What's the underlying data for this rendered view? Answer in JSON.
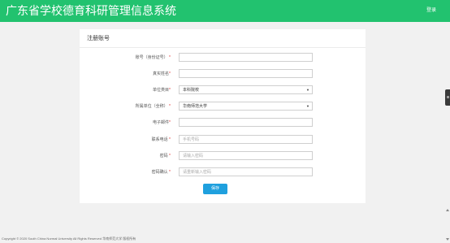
{
  "header": {
    "title": "广东省学校德育科研管理信息系统",
    "login_label": "登录"
  },
  "card": {
    "heading": "注册账号"
  },
  "form": {
    "fields": [
      {
        "label": "账号（身份证号）",
        "required": "*",
        "type": "text",
        "value": "",
        "placeholder": ""
      },
      {
        "label": "真实姓名",
        "required": "*",
        "type": "text",
        "value": "",
        "placeholder": ""
      },
      {
        "label": "单位类目",
        "required": "*",
        "type": "select",
        "value": "本科院校",
        "placeholder": ""
      },
      {
        "label": "所属单位（全称）",
        "required": "*",
        "type": "select",
        "value": "华南师范大学",
        "placeholder": ""
      },
      {
        "label": "电子邮件",
        "required": "*",
        "type": "text",
        "value": "",
        "placeholder": ""
      },
      {
        "label": "联系电话",
        "required": "*",
        "type": "text",
        "value": "",
        "placeholder": "手机号码"
      },
      {
        "label": "密码",
        "required": "*",
        "type": "password",
        "value": "",
        "placeholder": "请输入密码"
      },
      {
        "label": "密码确认",
        "required": "*",
        "type": "password",
        "value": "",
        "placeholder": "请重新输入密码"
      }
    ],
    "save_label": "保存"
  },
  "footer": {
    "copyright": "Copyright © 2020 South China Normal University All Rights Reserved 华南师范大学 版权所有"
  },
  "colors": {
    "header_bg": "#22c26f",
    "button_bg": "#1fa0de",
    "required": "#e03030"
  },
  "icons": {
    "select_caret": "chevron-down-icon"
  }
}
